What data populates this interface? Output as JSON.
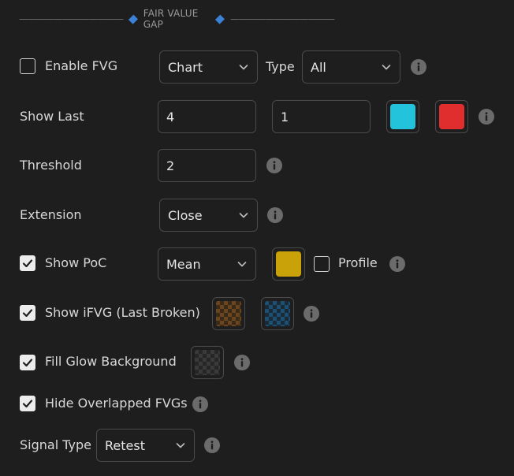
{
  "header": {
    "dashes_left": "————————————",
    "title": "FAIR VALUE GAP",
    "dashes_right": "————————————"
  },
  "colors": {
    "accent_diamond": "#3b82d6",
    "show_last_up": "#22c3db",
    "show_last_down": "#e02d2d",
    "poc": "#c9a20a",
    "ifvg_a": "#8a5a22",
    "ifvg_b": "#1d4f72",
    "glow": "#3a3a3a"
  },
  "rows": {
    "enable_fvg": {
      "label": "Enable FVG",
      "checked": false,
      "select_value": "Chart",
      "type_label": "Type",
      "type_value": "All"
    },
    "show_last": {
      "label": "Show Last",
      "value1": "4",
      "value2": "1"
    },
    "threshold": {
      "label": "Threshold",
      "value": "2"
    },
    "extension": {
      "label": "Extension",
      "value": "Close"
    },
    "show_poc": {
      "label": "Show PoC",
      "checked": true,
      "value": "Mean",
      "profile_label": "Profile",
      "profile_checked": false
    },
    "show_ifvg": {
      "label": "Show iFVG (Last Broken)",
      "checked": true
    },
    "fill_glow": {
      "label": "Fill Glow Background",
      "checked": true
    },
    "hide_overlap": {
      "label": "Hide Overlapped FVGs",
      "checked": true
    },
    "signal_type": {
      "label": "Signal Type",
      "value": "Retest"
    }
  }
}
